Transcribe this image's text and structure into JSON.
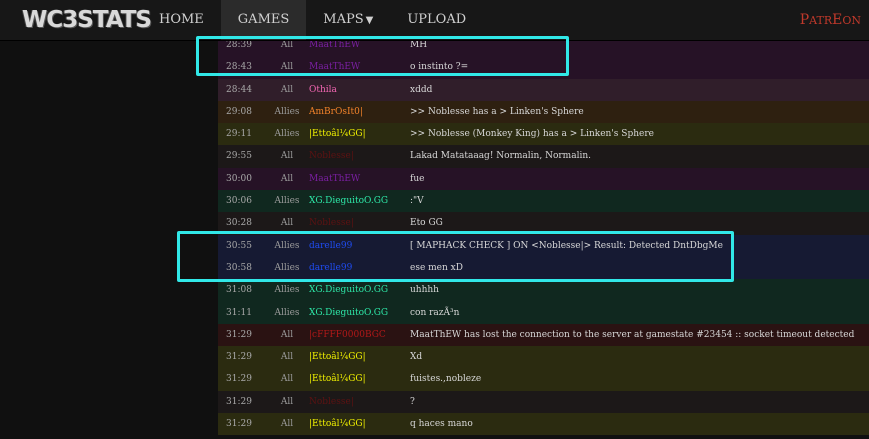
{
  "brand": {
    "logo_text": "WC3STATS"
  },
  "nav": {
    "home": "HOME",
    "games": "GAMES",
    "maps": "MAPS",
    "upload": "UPLOAD",
    "patreon_p": "P",
    "patreon_atr": "ATR",
    "patreon_e": "E",
    "patreon_on": "ON"
  },
  "chat": {
    "rows": [
      {
        "time": "28:39",
        "scope": "All",
        "player": "MaatThEW",
        "message": "MH",
        "player_color": "#7a1fa2",
        "bg": "#261226"
      },
      {
        "time": "28:43",
        "scope": "All",
        "player": "MaatThEW",
        "message": "o instinto ?=",
        "player_color": "#7a1fa2",
        "bg": "#261226"
      },
      {
        "time": "28:44",
        "scope": "All",
        "player": "Othila",
        "message": "xddd",
        "player_color": "#f266b2",
        "bg": "#301e2a"
      },
      {
        "time": "29:08",
        "scope": "Allies",
        "player": "AmBrOsIt0|",
        "message": ">> Noblesse has a > Linken's Sphere",
        "player_color": "#f2822a",
        "bg": "#2e2010"
      },
      {
        "time": "29:11",
        "scope": "Allies",
        "player": "|Ettoâl¼GG|",
        "message": ">> Noblesse (Monkey King) has a > Linken's Sphere",
        "player_color": "#f2f200",
        "bg": "#2b2b10"
      },
      {
        "time": "29:55",
        "scope": "All",
        "player": "Noblesse|",
        "message": "Lakad Matataaag! Normalin, Normalin.",
        "player_color": "#5c1212",
        "bg": "#1c1818"
      },
      {
        "time": "30:00",
        "scope": "All",
        "player": "MaatThEW",
        "message": "fue",
        "player_color": "#7a1fa2",
        "bg": "#261226"
      },
      {
        "time": "30:06",
        "scope": "Allies",
        "player": "XG.DieguitoO.GG",
        "message": ":\"V",
        "player_color": "#2ee8a8",
        "bg": "#10281f"
      },
      {
        "time": "30:28",
        "scope": "All",
        "player": "Noblesse|",
        "message": "Eto GG",
        "player_color": "#5c1212",
        "bg": "#1c1818"
      },
      {
        "time": "30:55",
        "scope": "Allies",
        "player": "darelle99",
        "message": "[ MAPHACK CHECK ] ON <Noblesse|> Result: Detected DntDbgMe",
        "player_color": "#1f4cf2",
        "bg": "#161a33"
      },
      {
        "time": "30:58",
        "scope": "Allies",
        "player": "darelle99",
        "message": "ese men xD",
        "player_color": "#1f4cf2",
        "bg": "#161a33"
      },
      {
        "time": "31:08",
        "scope": "Allies",
        "player": "XG.DieguitoO.GG",
        "message": "uhhhh",
        "player_color": "#2ee8a8",
        "bg": "#10281f"
      },
      {
        "time": "31:11",
        "scope": "Allies",
        "player": "XG.DieguitoO.GG",
        "message": "con razÃ³n",
        "player_color": "#2ee8a8",
        "bg": "#10281f"
      },
      {
        "time": "31:29",
        "scope": "All",
        "player": "|cFFFF0000BGC",
        "message": "MaatThEW has lost the connection to the server at gamestate #23454 :: socket timeout detected",
        "player_color": "#b01818",
        "bg": "#2a1212"
      },
      {
        "time": "31:29",
        "scope": "All",
        "player": "|Ettoâl¼GG|",
        "message": "Xd",
        "player_color": "#f2f200",
        "bg": "#2b2b10"
      },
      {
        "time": "31:29",
        "scope": "All",
        "player": "|Ettoâl¼GG|",
        "message": "fuistes.,nobleze",
        "player_color": "#f2f200",
        "bg": "#2b2b10"
      },
      {
        "time": "31:29",
        "scope": "All",
        "player": "Noblesse|",
        "message": "?",
        "player_color": "#5c1212",
        "bg": "#1c1818"
      },
      {
        "time": "31:29",
        "scope": "All",
        "player": "|Ettoâl¼GG|",
        "message": "q haces mano",
        "player_color": "#f2f200",
        "bg": "#2b2b10"
      }
    ]
  },
  "highlights": {
    "color": "#31e8e8"
  }
}
